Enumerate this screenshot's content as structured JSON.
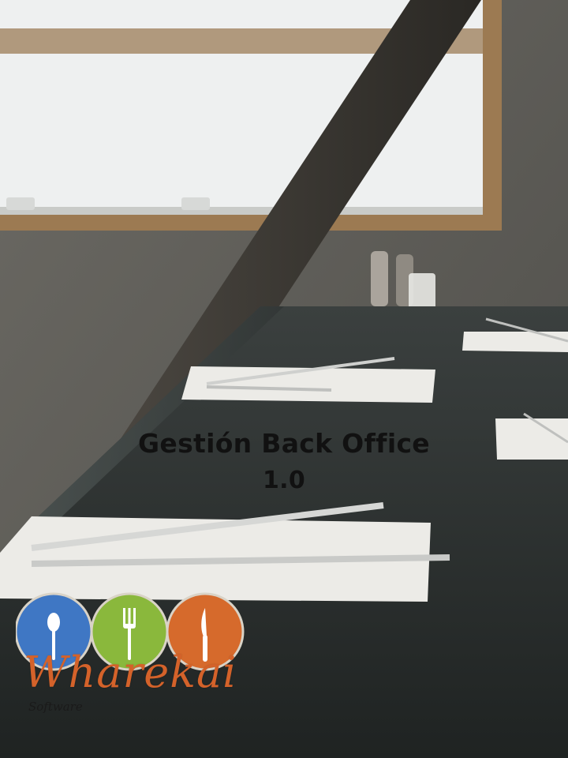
{
  "title": {
    "line1": "Gestión Back Office",
    "line2": "1.0"
  },
  "logo": {
    "brand": "Wharekai",
    "tagline": "Software",
    "circle_colors": [
      "#3f77c4",
      "#8ab83c",
      "#d66a2c"
    ],
    "icons": [
      "spoon-icon",
      "fork-icon",
      "knife-icon"
    ]
  }
}
